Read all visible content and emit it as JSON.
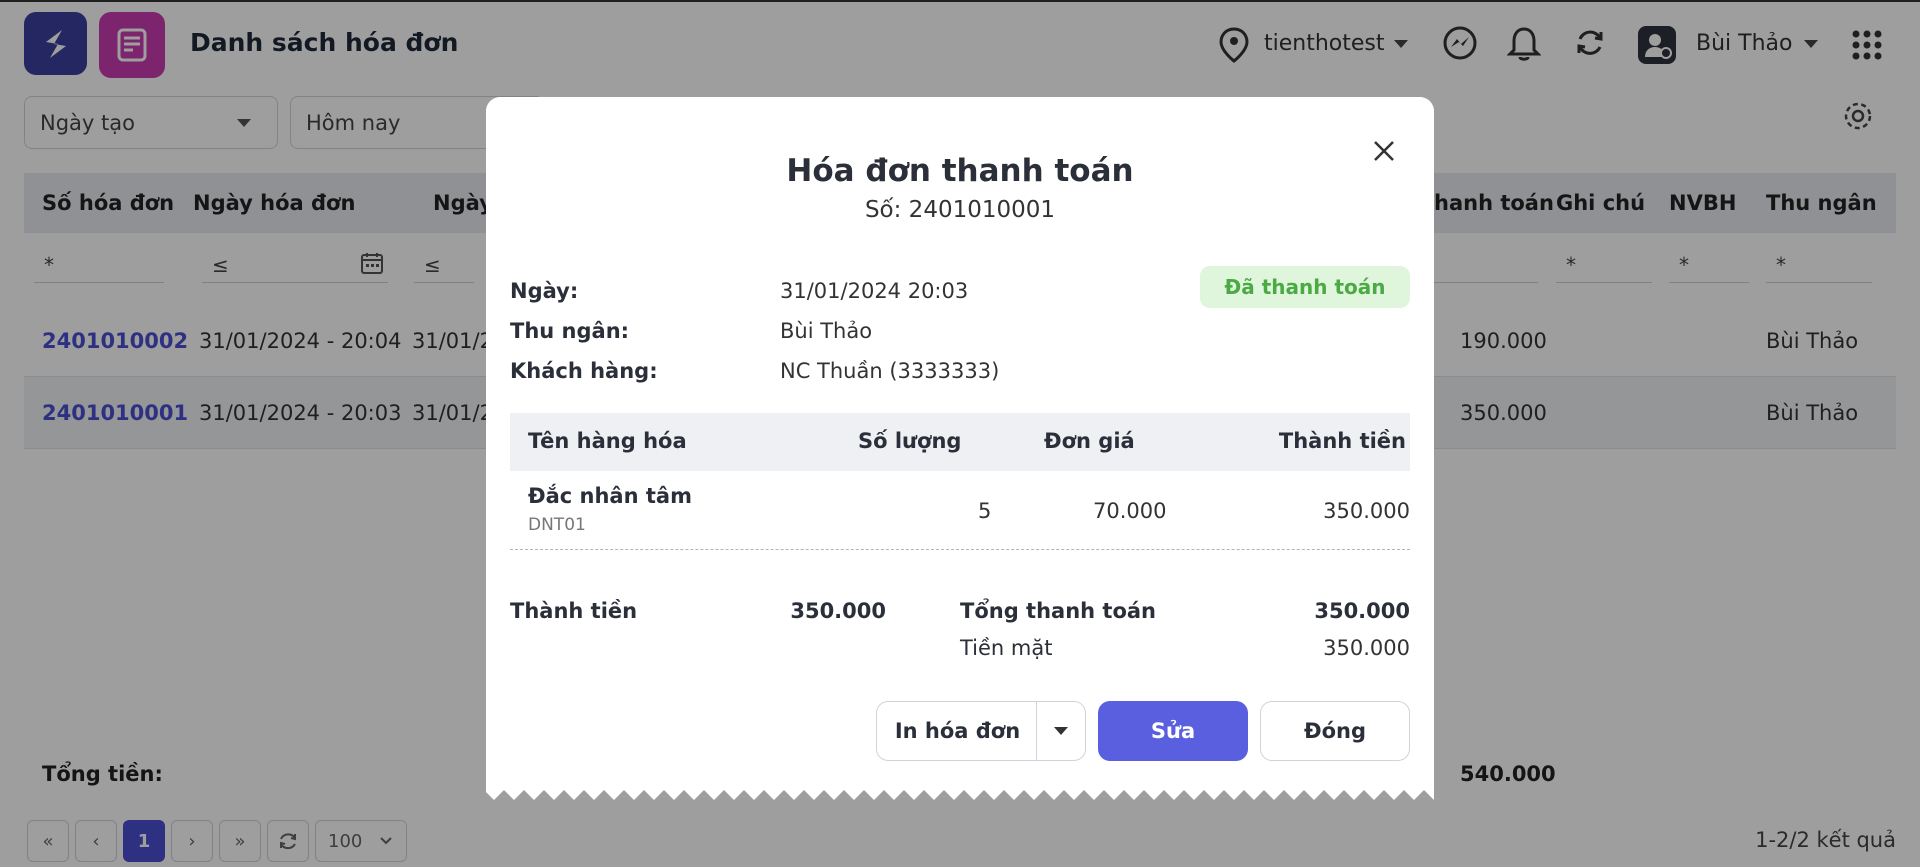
{
  "header": {
    "title": "Danh sách hóa đơn",
    "location": "tienthotest",
    "user": "Bùi Thảo"
  },
  "filters": {
    "date_type": "Ngày tạo",
    "date_range": "Hôm nay"
  },
  "table": {
    "columns": [
      "Số hóa đơn",
      "Ngày hóa đơn",
      "Ngày",
      "hanh toán",
      "Ghi chú",
      "NVBH",
      "Thu ngân"
    ],
    "filter_row": {
      "c1": "*",
      "c2": "≤",
      "c3": "≤",
      "c5": "*",
      "c6": "*",
      "c7": "*"
    },
    "rows": [
      {
        "id": "2401010002",
        "date": "31/01/2024 - 20:04",
        "date2": "31/01/2",
        "paid": "190.000",
        "cashier": "Bùi Thảo"
      },
      {
        "id": "2401010001",
        "date": "31/01/2024 - 20:03",
        "date2": "31/01/2",
        "paid": "350.000",
        "cashier": "Bùi Thảo"
      }
    ],
    "total_label": "Tổng tiền:",
    "total_value": "540.000"
  },
  "pagination": {
    "first": "«",
    "prev": "‹",
    "page": "1",
    "next": "›",
    "last": "»",
    "page_size": "100",
    "results": "1-2/2 kết quả"
  },
  "modal": {
    "title": "Hóa đơn thanh toán",
    "number": "Số: 2401010001",
    "status": "Đã thanh toán",
    "fields": [
      {
        "label": "Ngày:",
        "value": "31/01/2024 20:03"
      },
      {
        "label": "Thu ngân:",
        "value": "Bùi Thảo"
      },
      {
        "label": "Khách hàng:",
        "value": "NC Thuần (3333333)"
      }
    ],
    "items_header": {
      "name": "Tên hàng hóa",
      "qty": "Số lượng",
      "price": "Đơn giá",
      "total": "Thành tiền"
    },
    "items": [
      {
        "name": "Đắc nhân tâm",
        "code": "DNT01",
        "qty": "5",
        "price": "70.000",
        "total": "350.000"
      }
    ],
    "summary": {
      "subtotal_label": "Thành tiền",
      "subtotal": "350.000",
      "grand_label": "Tổng thanh toán",
      "grand": "350.000",
      "cash_label": "Tiền mặt",
      "cash": "350.000"
    },
    "buttons": {
      "print": "In hóa đơn",
      "edit": "Sửa",
      "close": "Đóng"
    }
  },
  "colors": {
    "accent": "#5a5fe0",
    "link": "#4b4fd0",
    "paid_bg": "#dff5dc",
    "paid_text": "#4caa44"
  }
}
